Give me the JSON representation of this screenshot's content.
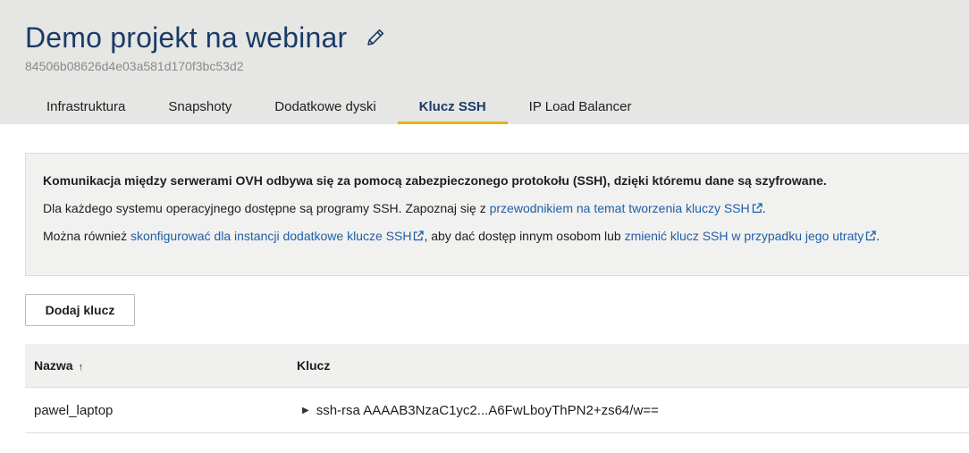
{
  "project": {
    "title": "Demo projekt na webinar",
    "id": "84506b08626d4e03a581d170f3bc53d2",
    "edit_icon": "pencil-icon"
  },
  "tabs": [
    {
      "label": "Infrastruktura",
      "active": false
    },
    {
      "label": "Snapshoty",
      "active": false
    },
    {
      "label": "Dodatkowe dyski",
      "active": false
    },
    {
      "label": "Klucz SSH",
      "active": true
    },
    {
      "label": "IP Load Balancer",
      "active": false
    }
  ],
  "info": {
    "line1": "Komunikacja między serwerami OVH odbywa się za pomocą zabezpieczonego protokołu (SSH), dzięki któremu dane są szyfrowane.",
    "line2_prefix": "Dla każdego systemu operacyjnego dostępne są programy SSH. Zapoznaj się z ",
    "line2_link": "przewodnikiem na temat tworzenia kluczy SSH",
    "line2_suffix": ".",
    "line3_prefix": "Można również ",
    "line3_link1": "skonfigurować dla instancji dodatkowe klucze SSH",
    "line3_middle": ", aby dać dostęp innym osobom lub ",
    "line3_link2": "zmienić klucz SSH w przypadku jego utraty",
    "line3_suffix": "."
  },
  "actions": {
    "add_key": "Dodaj klucz"
  },
  "table": {
    "columns": {
      "name": "Nazwa",
      "key": "Klucz"
    },
    "sort": {
      "column": "name",
      "direction": "ascending",
      "icon": "↑"
    },
    "rows": [
      {
        "name": "pawel_laptop",
        "key": "ssh-rsa AAAAB3NzaC1yc2...A6FwLboyThPN2+zs64/w=="
      }
    ]
  },
  "colors": {
    "header_bg": "#e6e6e4",
    "title": "#1a3b66",
    "link": "#1f5fa8",
    "tab_underline": "#e8b20c"
  }
}
